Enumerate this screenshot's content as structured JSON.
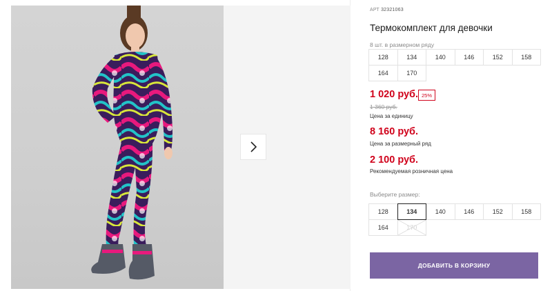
{
  "product": {
    "sku_label": "АРТ",
    "sku": "32321063",
    "title": "Термокомплект для девочки"
  },
  "size_row": {
    "label": "8 шт. в размерном ряду",
    "sizes": [
      "128",
      "134",
      "140",
      "146",
      "152",
      "158",
      "164",
      "170"
    ]
  },
  "prices": {
    "unit_price": "1 020 руб.",
    "discount": "25%",
    "old_price": "1 360 руб.",
    "unit_note": "Цена за единицу",
    "row_price": "8 160 руб.",
    "row_note": "Цена за размерный ряд",
    "retail_price": "2 100 руб.",
    "retail_note": "Рекомендуемая розничная цена"
  },
  "size_select": {
    "label": "Выберите размер:",
    "sizes": [
      "128",
      "134",
      "140",
      "146",
      "152",
      "158",
      "164",
      "170"
    ],
    "selected": "134",
    "unavailable": [
      "170"
    ]
  },
  "cart": {
    "add_label": "ДОБАВИТЬ В КОРЗИНУ"
  },
  "colors": {
    "accent": "#7b65a3",
    "price": "#d0021b"
  },
  "icons": {
    "next": "chevron-right-icon"
  }
}
